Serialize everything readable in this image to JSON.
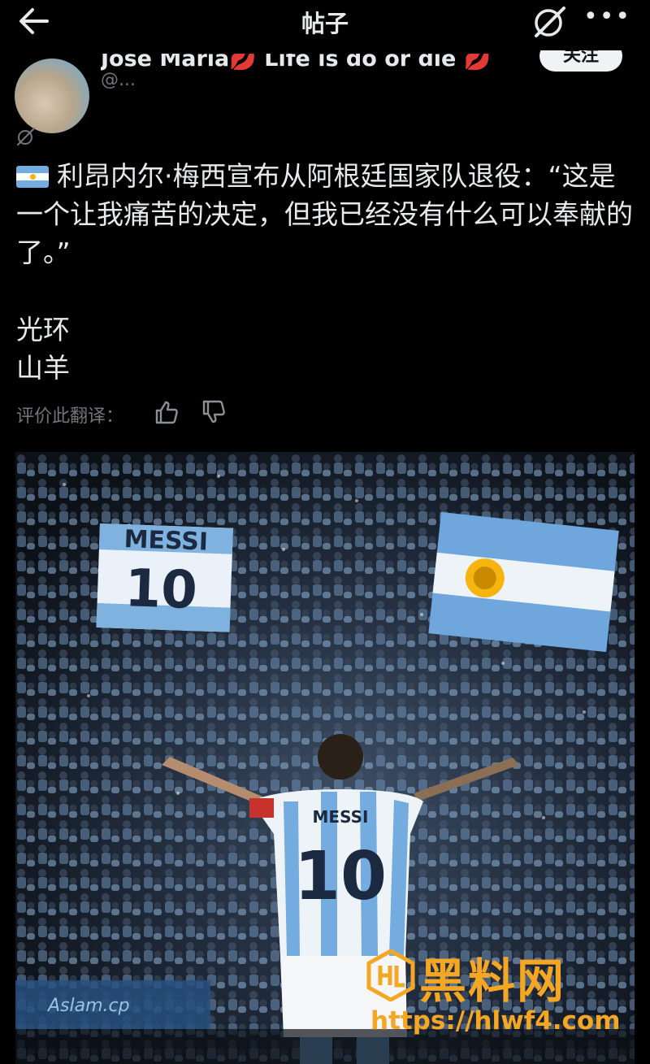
{
  "header": {
    "title": "帖子"
  },
  "author": {
    "name": "José María💋 Life is do or die 💋",
    "handle": "@..."
  },
  "follow_label": "关注",
  "post": {
    "text": "利昂内尔·梅西宣布从阿根廷国家队退役：“这是一个让我痛苦的决定，但我已经没有什么可以奉献的了。”",
    "tags": [
      "光环",
      "山羊"
    ]
  },
  "rate_translation": {
    "label": "评价此翻译："
  },
  "photo": {
    "banner_text": "MESSI",
    "banner_number": "10",
    "jersey_name": "MESSI",
    "jersey_number": "10",
    "board_text": "Aslam.cp"
  },
  "watermark": {
    "brand": "黑料网",
    "url": "https://hlwf4.com"
  },
  "colors": {
    "background": "#000000",
    "text": "#e7e9ea",
    "muted": "#71767b",
    "argentina_blue": "#74acdf",
    "watermark": "#f5a623"
  }
}
